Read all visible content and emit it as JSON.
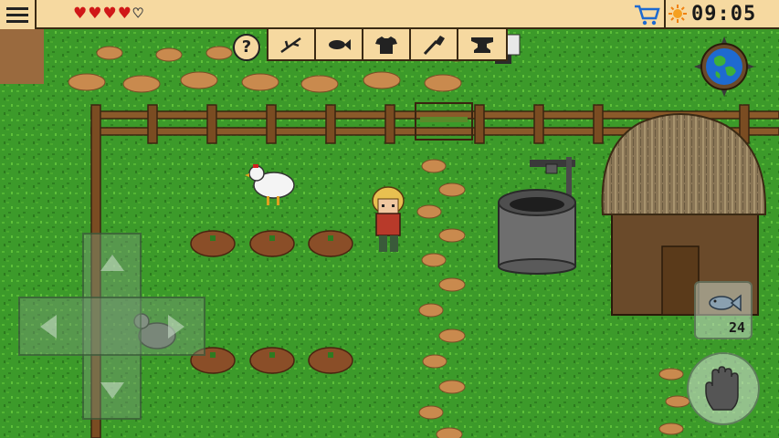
{
  "status_bar": {
    "health": {
      "full_hearts": 4,
      "max_hearts": 5
    },
    "clock": "09:05",
    "icons": [
      "menu-icon",
      "heart-icon",
      "cart-icon",
      "sun-icon"
    ],
    "colors": {
      "bar_bg": "#f6d9a0",
      "heart": "#d01818",
      "border": "#3a2a14"
    }
  },
  "craft_bar": {
    "help_label": "?",
    "categories": [
      {
        "name": "branch",
        "icon": "branch-icon"
      },
      {
        "name": "fish",
        "icon": "fish-icon"
      },
      {
        "name": "shirt",
        "icon": "shirt-icon"
      },
      {
        "name": "shovel",
        "icon": "shovel-icon"
      },
      {
        "name": "anvil",
        "icon": "anvil-icon"
      }
    ]
  },
  "minimap": {
    "icon": "compass-icon"
  },
  "controls": {
    "dpad": [
      "dpad-up",
      "dpad-down",
      "dpad-left",
      "dpad-right"
    ],
    "quick_item": {
      "icon": "fish-icon",
      "count": "24"
    },
    "action": {
      "icon": "hand-icon"
    }
  },
  "world": {
    "grass_color": "#3c9a2a",
    "objects": [
      "white-chicken",
      "gray-chicken",
      "player-character",
      "stone-well",
      "thatched-hut",
      "wooden-fence",
      "farm-plots",
      "dirt-path"
    ]
  }
}
